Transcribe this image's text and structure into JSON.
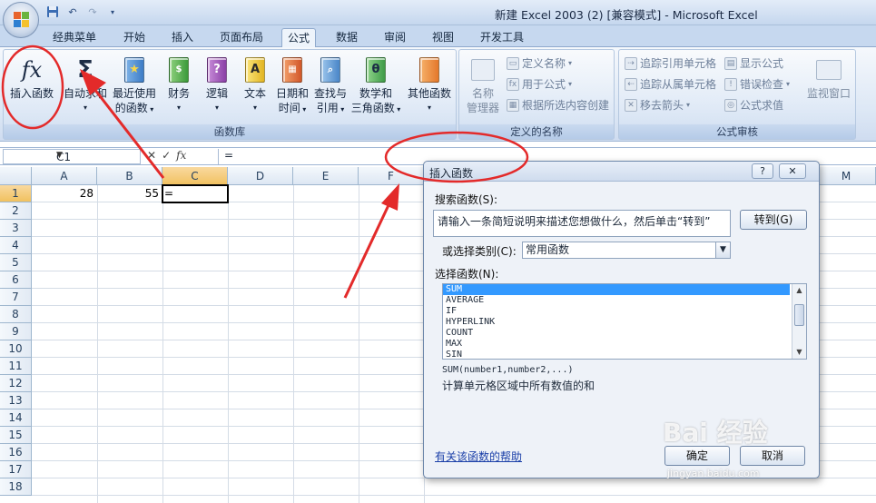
{
  "window": {
    "title": "新建 Excel 2003 (2)  [兼容模式] - Microsoft Excel"
  },
  "qat": {
    "save_icon": "save-icon",
    "undo_icon": "undo-icon",
    "redo_icon": "redo-icon",
    "customize_icon": "customize-qat-icon"
  },
  "tabs": [
    "经典菜单",
    "开始",
    "插入",
    "页面布局",
    "公式",
    "数据",
    "审阅",
    "视图",
    "开发工具"
  ],
  "active_tab": "公式",
  "ribbon": {
    "function_library": {
      "label": "函数库",
      "insert_function": "插入函数",
      "autosum_line1": "自动求和",
      "recent_line1": "最近使用",
      "recent_line2": "的函数",
      "financial": "财务",
      "logical": "逻辑",
      "text": "文本",
      "datetime_line1": "日期和",
      "datetime_line2": "时间",
      "lookup_line1": "查找与",
      "lookup_line2": "引用",
      "math_line1": "数学和",
      "math_line2": "三角函数",
      "more": "其他函数"
    },
    "defined_names": {
      "label": "定义的名称",
      "name_manager_line1": "名称",
      "name_manager_line2": "管理器",
      "define_name": "定义名称",
      "use_in_formula": "用于公式",
      "create_from_selection": "根据所选内容创建"
    },
    "formula_auditing": {
      "label": "公式审核",
      "trace_precedents": "追踪引用单元格",
      "trace_dependents": "追踪从属单元格",
      "remove_arrows": "移去箭头",
      "show_formulas": "显示公式",
      "error_checking": "错误检查",
      "evaluate_formula": "公式求值",
      "watch_window": "监视窗口"
    }
  },
  "formula_bar": {
    "name_box": "C1",
    "formula": "="
  },
  "sheet": {
    "columns": [
      "A",
      "B",
      "C",
      "D",
      "E",
      "F",
      "M"
    ],
    "rows": [
      "1",
      "2",
      "3",
      "4",
      "5",
      "6",
      "7",
      "8",
      "9",
      "10",
      "11",
      "12",
      "13",
      "14",
      "15",
      "16",
      "17",
      "18"
    ],
    "cells": {
      "A1": "28",
      "B1": "55",
      "C1": "="
    }
  },
  "dialog": {
    "title": "插入函数",
    "help": "?",
    "search_label": "搜索函数(S):",
    "search_value": "请输入一条简短说明来描述您想做什么，然后单击“转到”",
    "go_button": "转到(G)",
    "category_label": "或选择类别(C):",
    "category_value": "常用函数",
    "select_label": "选择函数(N):",
    "functions": [
      "SUM",
      "AVERAGE",
      "IF",
      "HYPERLINK",
      "COUNT",
      "MAX",
      "SIN"
    ],
    "selected_function": "SUM",
    "signature": "SUM(number1,number2,...)",
    "description": "计算单元格区域中所有数值的和",
    "help_link": "有关该函数的帮助",
    "ok_button": "确定",
    "cancel_button": "取消"
  },
  "watermark": {
    "text": "Bai 经验",
    "url": "jingyan.baidu.com"
  },
  "colors": {
    "annotation_red": "#e32a2a",
    "selection_blue": "#3399ff",
    "ribbon_bg": "#dce7f5"
  }
}
